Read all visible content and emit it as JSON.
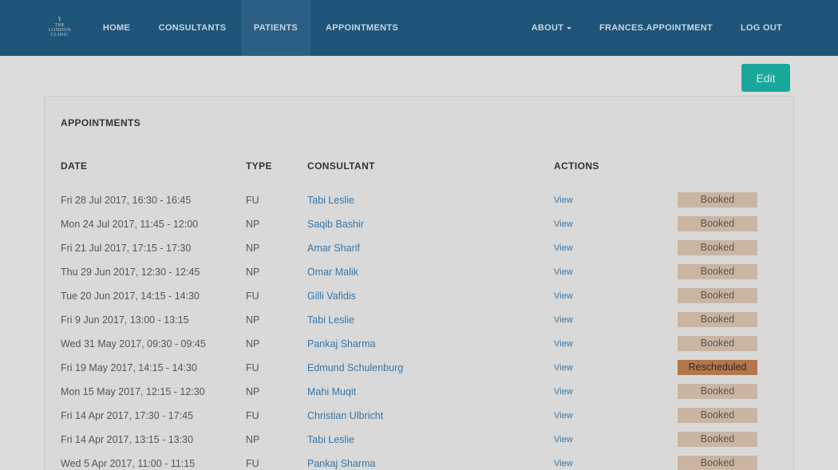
{
  "nav": {
    "logo_text": [
      "THE",
      "LONDON",
      "CLINIC"
    ],
    "logo_mark": "⚕",
    "home": "HOME",
    "consultants": "CONSULTANTS",
    "patients": "PATIENTS",
    "appointments": "APPOINTMENTS",
    "about": "ABOUT",
    "user": "FRANCES.APPOINTMENT",
    "logout": "LOG OUT"
  },
  "edit_label": "Edit",
  "panel": {
    "title": "APPOINTMENTS",
    "headers": {
      "date": "DATE",
      "type": "TYPE",
      "consultant": "CONSULTANT",
      "actions": "ACTIONS"
    },
    "rows": [
      {
        "date": "Fri 28 Jul 2017, 16:30 - 16:45",
        "type": "FU",
        "consultant": "Tabi Leslie",
        "action": "View",
        "status": "Booked"
      },
      {
        "date": "Mon 24 Jul 2017, 11:45 - 12:00",
        "type": "NP",
        "consultant": "Saqib Bashir",
        "action": "View",
        "status": "Booked"
      },
      {
        "date": "Fri 21 Jul 2017, 17:15 - 17:30",
        "type": "NP",
        "consultant": "Amar Sharif",
        "action": "View",
        "status": "Booked"
      },
      {
        "date": "Thu 29 Jun 2017, 12:30 - 12:45",
        "type": "NP",
        "consultant": "Omar Malik",
        "action": "View",
        "status": "Booked"
      },
      {
        "date": "Tue 20 Jun 2017, 14:15 - 14:30",
        "type": "FU",
        "consultant": "Gilli Vafidis",
        "action": "View",
        "status": "Booked"
      },
      {
        "date": "Fri 9 Jun 2017, 13:00 - 13:15",
        "type": "NP",
        "consultant": "Tabi Leslie",
        "action": "View",
        "status": "Booked"
      },
      {
        "date": "Wed 31 May 2017, 09:30 - 09:45",
        "type": "NP",
        "consultant": "Pankaj Sharma",
        "action": "View",
        "status": "Booked"
      },
      {
        "date": "Fri 19 May 2017, 14:15 - 14:30",
        "type": "FU",
        "consultant": "Edmund Schulenburg",
        "action": "View",
        "status": "Rescheduled"
      },
      {
        "date": "Mon 15 May 2017, 12:15 - 12:30",
        "type": "NP",
        "consultant": "Mahi Muqit",
        "action": "View",
        "status": "Booked"
      },
      {
        "date": "Fri 14 Apr 2017, 17:30 - 17:45",
        "type": "FU",
        "consultant": "Christian Ulbricht",
        "action": "View",
        "status": "Booked"
      },
      {
        "date": "Fri 14 Apr 2017, 13:15 - 13:30",
        "type": "NP",
        "consultant": "Tabi Leslie",
        "action": "View",
        "status": "Booked"
      },
      {
        "date": "Wed 5 Apr 2017, 11:00 - 11:15",
        "type": "FU",
        "consultant": "Pankaj Sharma",
        "action": "View",
        "status": "Booked"
      }
    ]
  },
  "colors": {
    "navbar": "#1e5478",
    "edit_button": "#1aa79b",
    "link": "#3676a8",
    "booked": "#c9b5a2",
    "rescheduled": "#b5764c"
  }
}
